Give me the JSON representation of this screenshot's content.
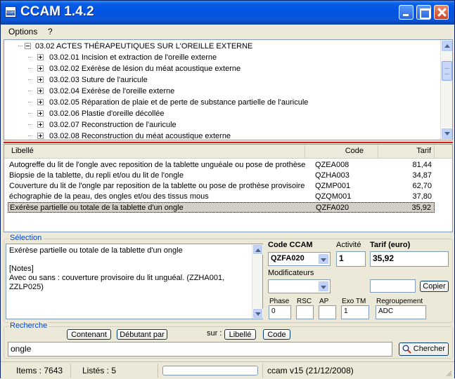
{
  "window": {
    "title": "CCAM 1.4.2",
    "app_icon_text": "ccam"
  },
  "menu": {
    "items": [
      "Options",
      "?"
    ]
  },
  "tree": {
    "parent": {
      "label": "03.02 ACTES THÉRAPEUTIQUES SUR L'OREILLE EXTERNE",
      "expanded": true
    },
    "children": [
      "03.02.01 Incision et extraction de l'oreille externe",
      "03.02.02 Exérèse de lésion du méat acoustique externe",
      "03.02.03 Suture de l'auricule",
      "03.02.04 Exérèse de l'oreille externe",
      "03.02.05 Réparation de plaie et de perte de substance partielle de l'auricule",
      "03.02.06 Plastie d'oreille décollée",
      "03.02.07 Reconstruction de l'auricule",
      "03.02.08 Reconstruction du méat acoustique externe"
    ]
  },
  "results": {
    "columns": [
      "Libellé",
      "Code",
      "Tarif"
    ],
    "rows": [
      {
        "libelle": "Autogreffe du lit de l'ongle avec reposition de la tablette unguéale ou pose de prothèse",
        "code": "QZEA008",
        "tarif": "81,44",
        "selected": false
      },
      {
        "libelle": "Biopsie de la tablette, du repli et/ou du lit de l'ongle",
        "code": "QZHA003",
        "tarif": "34,87",
        "selected": false
      },
      {
        "libelle": "Couverture du lit de l'ongle par reposition de la tablette ou pose de prothèse provisoire",
        "code": "QZMP001",
        "tarif": "62,70",
        "selected": false
      },
      {
        "libelle": "échographie de la peau, des ongles et/ou des tissus mous",
        "code": "QZQM001",
        "tarif": "37,80",
        "selected": false
      },
      {
        "libelle": "Exérèse partielle ou totale de la tablette d'un ongle",
        "code": "QZFA020",
        "tarif": "35,92",
        "selected": true
      }
    ]
  },
  "selection": {
    "group_title": "Sélection",
    "description": "Exérèse partielle ou totale de la tablette d'un ongle\n\n[Notes]\nAvec ou sans : couverture provisoire du lit unguéal. (ZZHA001, ZZLP025)",
    "code_label": "Code CCAM",
    "code_value": "QZFA020",
    "activite_label": "Activité",
    "activite_value": "1",
    "tarif_label": "Tarif (euro)",
    "tarif_value": "35,92",
    "modificateurs_label": "Modificateurs",
    "modificateurs_value": "",
    "extra_value": "",
    "copier_label": "Copier",
    "phase_label": "Phase",
    "phase_value": "0",
    "rsc_label": "RSC",
    "rsc_value": "",
    "ap_label": "AP",
    "ap_value": "",
    "exotm_label": "Exo TM",
    "exotm_value": "1",
    "regroupement_label": "Regroupement",
    "regroupement_value": "ADC"
  },
  "search": {
    "group_title": "Recherche",
    "contenant_label": "Contenant",
    "debutant_label": "Débutant par",
    "sur_label": "sur :",
    "libelle_label": "Libellé",
    "code_label": "Code",
    "query": "ongle",
    "search_button": "Chercher"
  },
  "status": {
    "items": "Items : 7643",
    "listes": "Listés : 5",
    "version": "ccam v15 (21/12/2008)",
    "progress": 0
  }
}
